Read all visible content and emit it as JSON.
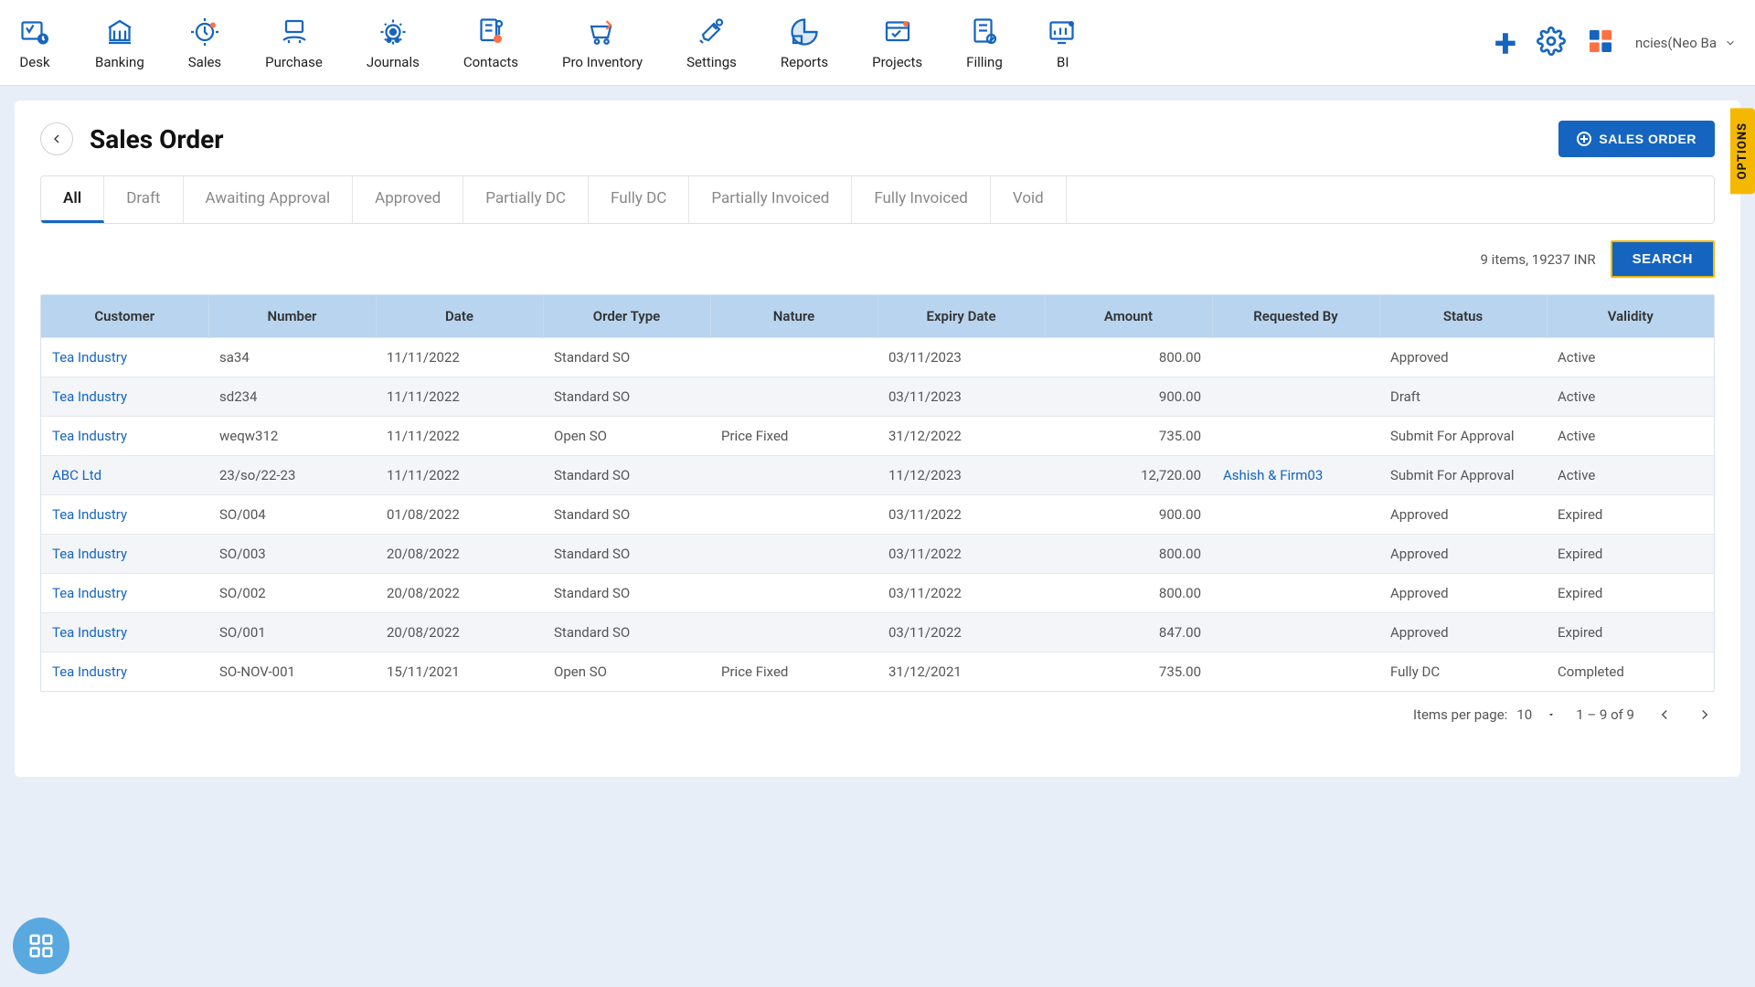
{
  "nav": {
    "items": [
      {
        "label": "Desk"
      },
      {
        "label": "Banking"
      },
      {
        "label": "Sales"
      },
      {
        "label": "Purchase"
      },
      {
        "label": "Journals"
      },
      {
        "label": "Contacts"
      },
      {
        "label": "Pro Inventory"
      },
      {
        "label": "Settings"
      },
      {
        "label": "Reports"
      },
      {
        "label": "Projects"
      },
      {
        "label": "Filling"
      },
      {
        "label": "BI"
      }
    ],
    "org_label": "ncies(Neo Ba"
  },
  "page": {
    "title": "Sales Order",
    "new_button": "SALES ORDER"
  },
  "tabs": [
    {
      "label": "All",
      "active": true
    },
    {
      "label": "Draft"
    },
    {
      "label": "Awaiting Approval"
    },
    {
      "label": "Approved"
    },
    {
      "label": "Partially DC"
    },
    {
      "label": "Fully DC"
    },
    {
      "label": "Partially Invoiced"
    },
    {
      "label": "Fully Invoiced"
    },
    {
      "label": "Void"
    }
  ],
  "summary": {
    "count_text": "9 items, 19237 INR",
    "search_label": "SEARCH"
  },
  "table": {
    "headers": [
      "Customer",
      "Number",
      "Date",
      "Order Type",
      "Nature",
      "Expiry Date",
      "Amount",
      "Requested By",
      "Status",
      "Validity"
    ],
    "rows": [
      {
        "customer": "Tea Industry",
        "number": "sa34",
        "date": "11/11/2022",
        "order_type": "Standard SO",
        "nature": "",
        "expiry": "03/11/2023",
        "amount": "800.00",
        "requested_by": "",
        "status": "Approved",
        "validity": "Active"
      },
      {
        "customer": "Tea Industry",
        "number": "sd234",
        "date": "11/11/2022",
        "order_type": "Standard SO",
        "nature": "",
        "expiry": "03/11/2023",
        "amount": "900.00",
        "requested_by": "",
        "status": "Draft",
        "validity": "Active"
      },
      {
        "customer": "Tea Industry",
        "number": "weqw312",
        "date": "11/11/2022",
        "order_type": "Open SO",
        "nature": "Price Fixed",
        "expiry": "31/12/2022",
        "amount": "735.00",
        "requested_by": "",
        "status": "Submit For Approval",
        "validity": "Active"
      },
      {
        "customer": "ABC Ltd",
        "number": "23/so/22-23",
        "date": "11/11/2022",
        "order_type": "Standard SO",
        "nature": "",
        "expiry": "11/12/2023",
        "amount": "12,720.00",
        "requested_by": "Ashish & Firm03",
        "status": "Submit For Approval",
        "validity": "Active"
      },
      {
        "customer": "Tea Industry",
        "number": "SO/004",
        "date": "01/08/2022",
        "order_type": "Standard SO",
        "nature": "",
        "expiry": "03/11/2022",
        "amount": "900.00",
        "requested_by": "",
        "status": "Approved",
        "validity": "Expired"
      },
      {
        "customer": "Tea Industry",
        "number": "SO/003",
        "date": "20/08/2022",
        "order_type": "Standard SO",
        "nature": "",
        "expiry": "03/11/2022",
        "amount": "800.00",
        "requested_by": "",
        "status": "Approved",
        "validity": "Expired"
      },
      {
        "customer": "Tea Industry",
        "number": "SO/002",
        "date": "20/08/2022",
        "order_type": "Standard SO",
        "nature": "",
        "expiry": "03/11/2022",
        "amount": "800.00",
        "requested_by": "",
        "status": "Approved",
        "validity": "Expired"
      },
      {
        "customer": "Tea Industry",
        "number": "SO/001",
        "date": "20/08/2022",
        "order_type": "Standard SO",
        "nature": "",
        "expiry": "03/11/2022",
        "amount": "847.00",
        "requested_by": "",
        "status": "Approved",
        "validity": "Expired"
      },
      {
        "customer": "Tea Industry",
        "number": "SO-NOV-001",
        "date": "15/11/2021",
        "order_type": "Open SO",
        "nature": "Price Fixed",
        "expiry": "31/12/2021",
        "amount": "735.00",
        "requested_by": "",
        "status": "Fully DC",
        "validity": "Completed"
      }
    ]
  },
  "pagination": {
    "items_per_page_label": "Items per page:",
    "items_per_page_value": "10",
    "range_text": "1 – 9 of 9"
  },
  "options_tab": "OPTIONS"
}
